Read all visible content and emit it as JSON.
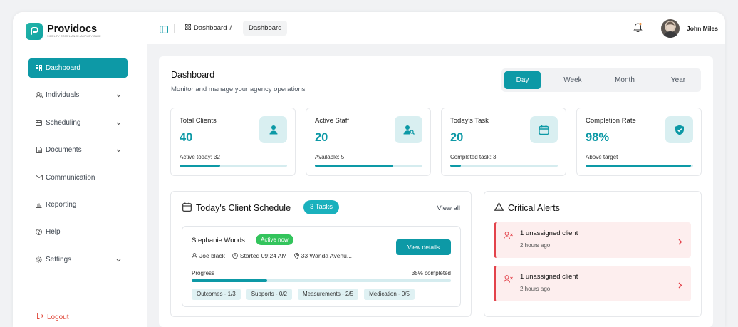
{
  "brand": {
    "name": "Providocs",
    "tagline": "SIMPLIFY COMPLIANCE. AMPLIFY CARE",
    "accent": "#0d99a6"
  },
  "sidebar": {
    "items": [
      {
        "label": "Dashboard",
        "icon": "grid-icon",
        "active": true
      },
      {
        "label": "Individuals",
        "icon": "users-icon",
        "expandable": true
      },
      {
        "label": "Scheduling",
        "icon": "calendar-icon",
        "expandable": true
      },
      {
        "label": "Documents",
        "icon": "document-icon",
        "expandable": true
      },
      {
        "label": "Communication",
        "icon": "mail-icon"
      },
      {
        "label": "Reporting",
        "icon": "bar-chart-icon"
      },
      {
        "label": "Help",
        "icon": "help-icon"
      },
      {
        "label": "Settings",
        "icon": "gear-icon",
        "expandable": true
      }
    ],
    "logout": "Logout"
  },
  "header": {
    "breadcrumb": [
      "Dashboard",
      "Dashboard"
    ],
    "user_name": "John Miles"
  },
  "page": {
    "title": "Dashboard",
    "subtitle": "Monitor and manage your agency operations"
  },
  "range": {
    "options": [
      "Day",
      "Week",
      "Month",
      "Year"
    ],
    "selected": "Day"
  },
  "stats": [
    {
      "label": "Total Clients",
      "value": "40",
      "note": "Active today: 32",
      "progress": 0.38,
      "icon": "user-icon"
    },
    {
      "label": "Active Staff",
      "value": "20",
      "note": "Available: 5",
      "progress": 0.73,
      "icon": "user-search-icon"
    },
    {
      "label": "Today's Task",
      "value": "20",
      "note": "Completed task: 3",
      "progress": 0.1,
      "icon": "calendar-icon"
    },
    {
      "label": "Completion Rate",
      "value": "98%",
      "note": "Above target",
      "progress": 0.98,
      "icon": "shield-check-icon"
    }
  ],
  "schedule": {
    "title": "Today's Client Schedule",
    "badge": "3 Tasks",
    "view_all": "View all",
    "client": {
      "name": "Stephanie Woods",
      "status": "Active now",
      "staff": "Joe black",
      "started": "Started 09:24 AM",
      "address": "33 Wanda  Avenu...",
      "button": "View details",
      "progress_label": "Progress",
      "progress_text": "35% completed",
      "progress": 0.29,
      "chips": [
        "Outcomes - 1/3",
        "Supports - 0/2",
        "Measurements - 2/5",
        "Medication - 0/5"
      ]
    }
  },
  "alerts": {
    "title": "Critical Alerts",
    "items": [
      {
        "text": "1 unassigned client",
        "time": "2 hours ago"
      },
      {
        "text": "1 unassigned client",
        "time": "2 hours ago"
      }
    ]
  }
}
